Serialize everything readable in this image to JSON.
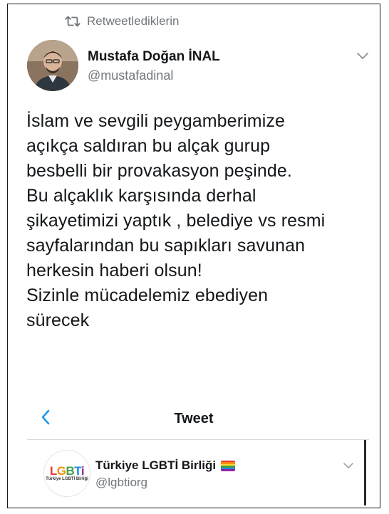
{
  "retweet": {
    "label": "Retweetlediklerin",
    "icon": "retweet-icon"
  },
  "tweet": {
    "author_name": "Mustafa Doğan İNAL",
    "author_handle": "@mustafadinal",
    "lines": [
      "İslam ve sevgili peygamberimize",
      "açıkça saldıran bu alçak gurup",
      "besbelli bir provakasyon peşinde.",
      "Bu alçaklık karşısında derhal",
      "şikayetimizi yaptık , belediye vs resmi",
      "sayfalarından bu sapıkları savunan",
      "herkesin haberi olsun!",
      "Sizinle mücadelemiz ebediyen",
      "sürecek"
    ]
  },
  "nav": {
    "title": "Tweet",
    "back_icon": "back-chevron-icon"
  },
  "quoted": {
    "author_name": "Türkiye LGBTİ Birliği",
    "author_handle": "@lgbtiorg",
    "avatar_logo": [
      "L",
      "G",
      "B",
      "T",
      "i"
    ],
    "avatar_sub": "Türkiye LGBTİ Birliği"
  },
  "colors": {
    "text": "#14171a",
    "secondary": "#71767b",
    "accent": "#1d9bf0",
    "divider": "#d9d9d9"
  }
}
